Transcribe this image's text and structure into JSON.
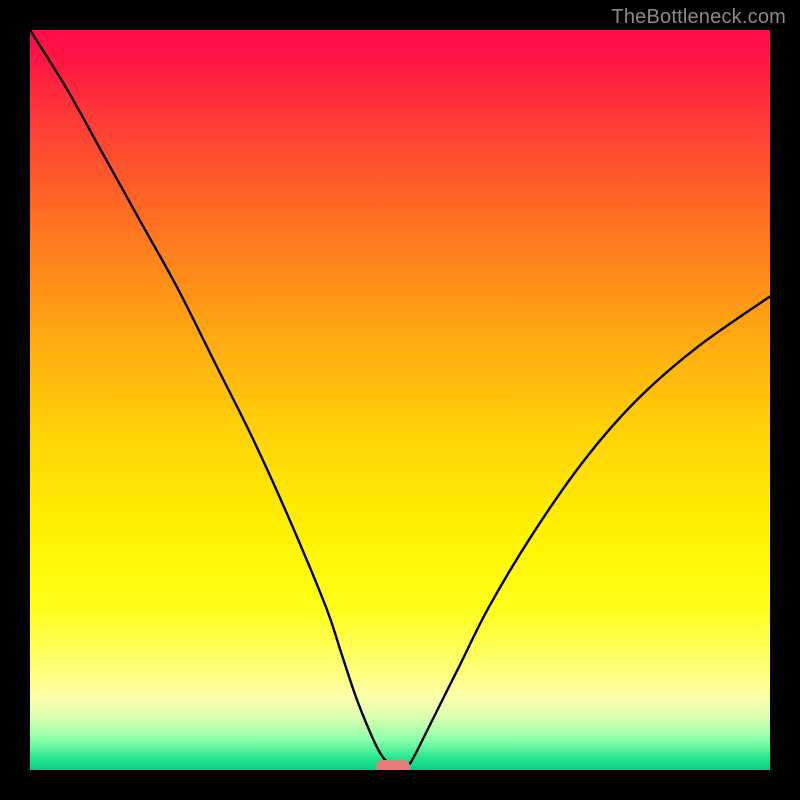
{
  "watermark": "TheBottleneck.com",
  "chart_data": {
    "type": "line",
    "title": "",
    "xlabel": "",
    "ylabel": "",
    "xlim": [
      0,
      100
    ],
    "ylim": [
      0,
      100
    ],
    "grid": false,
    "legend": false,
    "series": [
      {
        "name": "bottleneck-curve",
        "x": [
          0,
          5,
          10,
          15,
          20,
          25,
          30,
          35,
          40,
          42,
          44,
          46,
          47.5,
          49,
          50,
          51,
          52,
          54,
          58,
          62,
          68,
          75,
          82,
          90,
          100
        ],
        "values": [
          100,
          92,
          83,
          74,
          65,
          55,
          45,
          34,
          22,
          16,
          10,
          5,
          2,
          0.5,
          0.3,
          0.5,
          2,
          6,
          14,
          22,
          32,
          42,
          50,
          57,
          64
        ]
      }
    ],
    "marker": {
      "x": 49,
      "y": 0.4
    },
    "background_gradient": {
      "top_color": "#ff0b49",
      "mid_color": "#fff200",
      "bottom_color": "#07cf86"
    }
  }
}
